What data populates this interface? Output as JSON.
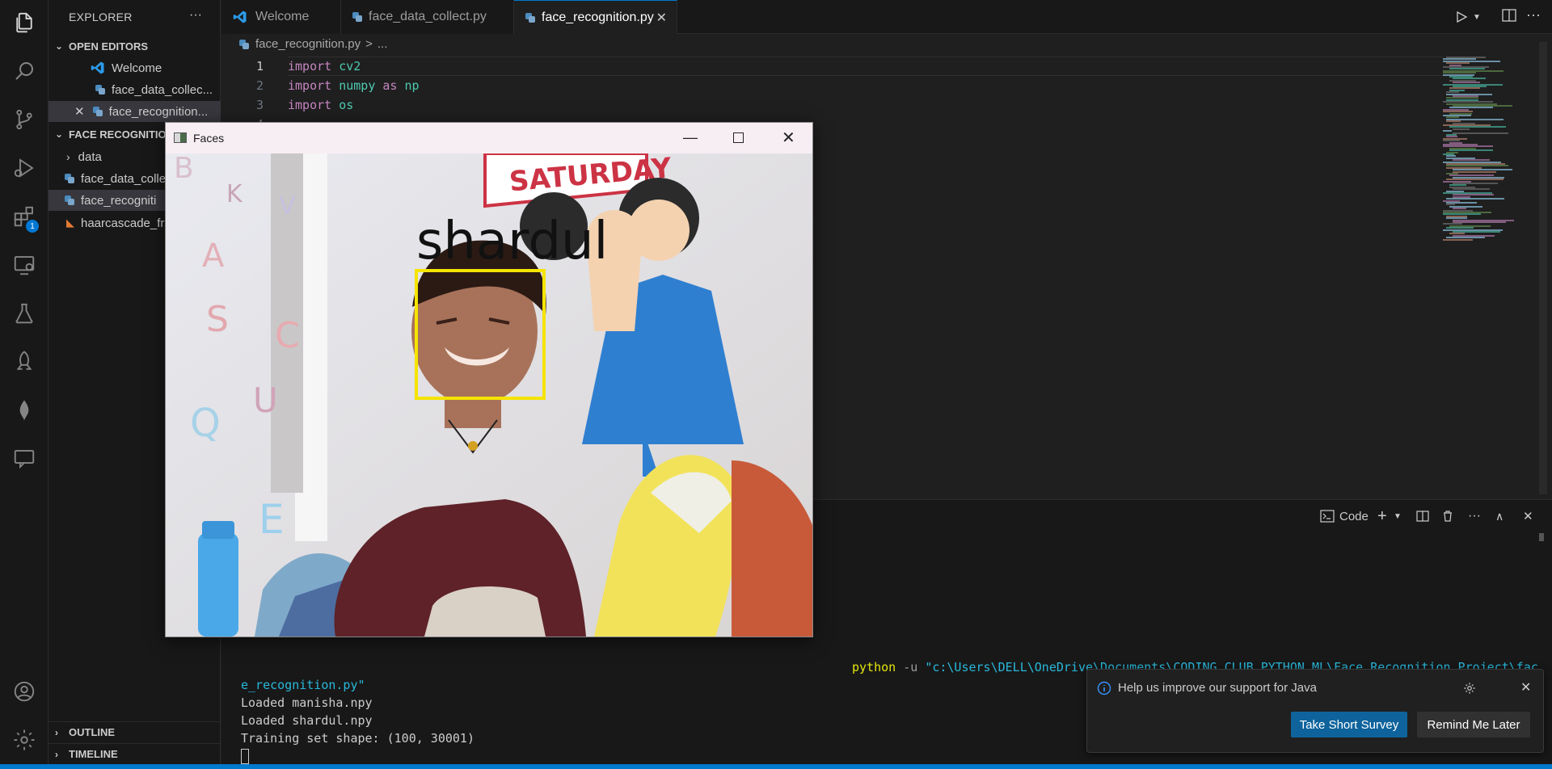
{
  "sidebar": {
    "title": "EXPLORER",
    "more": "···",
    "open_editors_label": "OPEN EDITORS",
    "open_editors": [
      {
        "label": "Welcome"
      },
      {
        "label": "face_data_collec..."
      },
      {
        "label": "face_recognition..."
      }
    ],
    "project_label": "FACE RECOGNITIO",
    "files": [
      {
        "label": "data"
      },
      {
        "label": "face_data_colle"
      },
      {
        "label": "face_recogniti"
      },
      {
        "label": "haarcascade_fr"
      }
    ],
    "outline_label": "OUTLINE",
    "timeline_label": "TIMELINE"
  },
  "activity": {
    "extensions_badge": "1"
  },
  "tabs": [
    {
      "label": "Welcome"
    },
    {
      "label": "face_data_collect.py"
    },
    {
      "label": "face_recognition.py"
    }
  ],
  "breadcrumb": {
    "file": "face_recognition.py",
    "sep": ">",
    "rest": "..."
  },
  "code": [
    {
      "num": "1",
      "kw": "import",
      "mod": "cv2",
      "as": "",
      "alias": ""
    },
    {
      "num": "2",
      "kw": "import",
      "mod": "numpy",
      "as": "as",
      "alias": "np"
    },
    {
      "num": "3",
      "kw": "import",
      "mod": "os",
      "as": "",
      "alias": ""
    },
    {
      "num": "4"
    }
  ],
  "panel": {
    "shell_label": "Code",
    "terminal": {
      "cmd_python": "python",
      "cmd_flag": "-u",
      "cmd_path": "\"c:\\Users\\DELL\\OneDrive\\Documents\\CODING CLUB PYTHON ML\\Face Recognition Project\\fac",
      "cmd_path_cont": "e_recognition.py\"",
      "line1": "Loaded manisha.npy",
      "line2": "Loaded shardul.npy",
      "line3": "Training set shape: (100, 30001)"
    }
  },
  "faces_window": {
    "title": "Faces",
    "overlay_name": "shardul",
    "poster_text": "SATURDAY",
    "box_color": "#f5e400"
  },
  "notification": {
    "message": "Help us improve our support for Java",
    "primary": "Take Short Survey",
    "secondary": "Remind Me Later"
  },
  "colors": {
    "accent": "#0078d4",
    "status": "#007acc"
  }
}
